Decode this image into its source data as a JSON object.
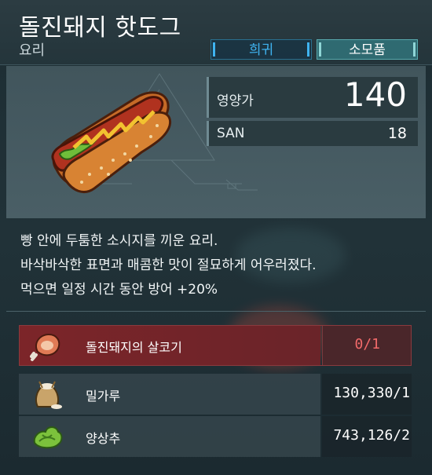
{
  "item": {
    "name": "돌진돼지 핫도그",
    "category": "요리",
    "rarity": "희귀",
    "type": "소모품",
    "icon": "hotdog-icon"
  },
  "stats": {
    "nutrition_label": "영양가",
    "nutrition_value": "140",
    "san_label": "SAN",
    "san_value": "18"
  },
  "description": [
    "빵 안에 두툼한 소시지를 끼운 요리.",
    "바삭바삭한 표면과 매콤한 맛이 절묘하게 어우러졌다.",
    "먹으면 일정 시간 동안 방어 +20%"
  ],
  "ingredients": [
    {
      "name": "돌진돼지의 살코기",
      "count": "0/1",
      "icon": "meat-icon",
      "insufficient": true
    },
    {
      "name": "밀가루",
      "count": "130,330/1",
      "icon": "flour-sack-icon",
      "insufficient": false
    },
    {
      "name": "양상추",
      "count": "743,126/2",
      "icon": "lettuce-icon",
      "insufficient": false
    }
  ],
  "colors": {
    "rarity_blue": "#3fb3f0",
    "insufficient_red": "#f26a6a",
    "insufficient_row": "#7c2529",
    "panel_bg": "#24353b"
  }
}
